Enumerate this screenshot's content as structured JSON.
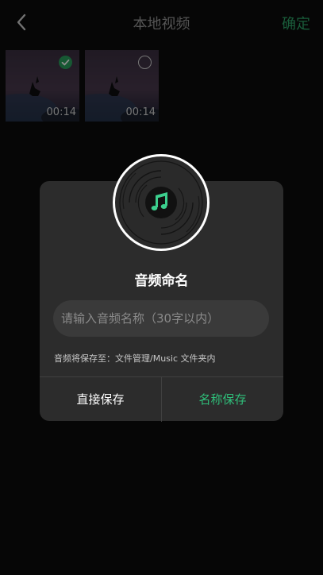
{
  "header": {
    "title": "本地视频",
    "confirm_label": "确定"
  },
  "videos": [
    {
      "duration": "00:14",
      "selected": true
    },
    {
      "duration": "00:14",
      "selected": false
    }
  ],
  "dialog": {
    "title": "音频命名",
    "input_placeholder": "请输入音频名称（30字以内）",
    "input_value": "",
    "save_path_text": "音频将保存至：文件管理/Music 文件夹内",
    "direct_save_label": "直接保存",
    "name_save_label": "名称保存"
  },
  "colors": {
    "accent_green": "#2fbf7a",
    "dialog_bg": "#2c2c2c",
    "page_bg": "#0b0b0b"
  },
  "icons": {
    "back": "chevron-left-icon",
    "check": "check-circle-icon",
    "music": "music-note-icon"
  }
}
